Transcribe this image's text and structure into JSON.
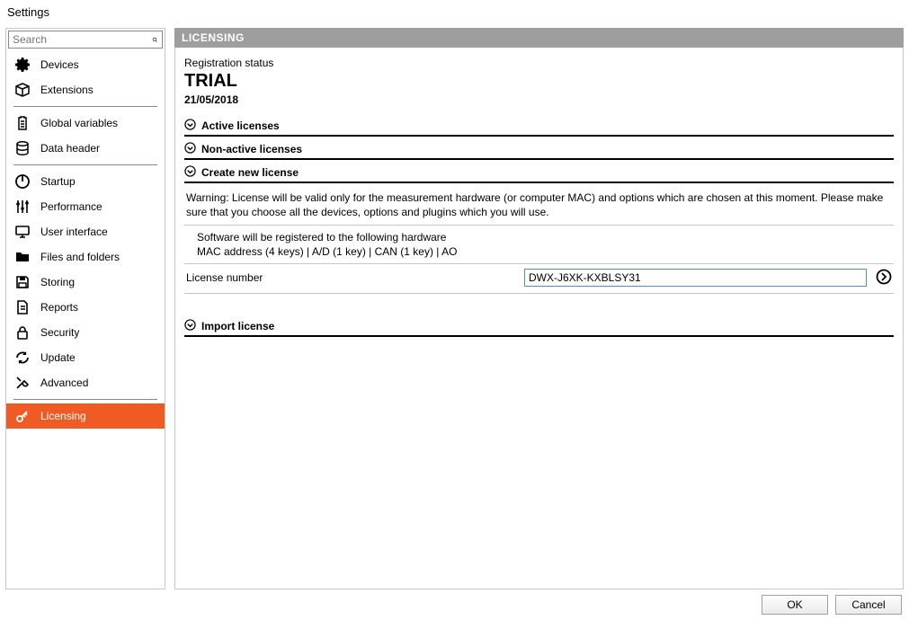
{
  "window": {
    "title": "Settings"
  },
  "search": {
    "placeholder": "Search"
  },
  "sidebar": {
    "groups": [
      {
        "items": [
          {
            "label": "Devices",
            "icon": "gear-icon"
          },
          {
            "label": "Extensions",
            "icon": "box-icon"
          }
        ]
      },
      {
        "items": [
          {
            "label": "Global variables",
            "icon": "clipboard-icon"
          },
          {
            "label": "Data header",
            "icon": "database-icon"
          }
        ]
      },
      {
        "items": [
          {
            "label": "Startup",
            "icon": "power-icon"
          },
          {
            "label": "Performance",
            "icon": "sliders-icon"
          },
          {
            "label": "User interface",
            "icon": "monitor-icon"
          },
          {
            "label": "Files and folders",
            "icon": "folder-icon"
          },
          {
            "label": "Storing",
            "icon": "save-icon"
          },
          {
            "label": "Reports",
            "icon": "document-icon"
          },
          {
            "label": "Security",
            "icon": "lock-icon"
          },
          {
            "label": "Update",
            "icon": "refresh-icon"
          },
          {
            "label": "Advanced",
            "icon": "tools-icon"
          }
        ]
      },
      {
        "items": [
          {
            "label": "Licensing",
            "icon": "key-icon",
            "active": true
          }
        ]
      }
    ]
  },
  "main": {
    "heading": "LICENSING",
    "registration_label": "Registration status",
    "status": "TRIAL",
    "date": "21/05/2018",
    "sections": {
      "active": {
        "title": "Active licenses"
      },
      "nonactive": {
        "title": "Non-active licenses"
      },
      "create": {
        "title": "Create new license",
        "warning": "Warning: License will be valid only for the measurement hardware (or computer MAC) and options which are chosen at this moment. Please make sure that you choose all the devices, options and plugins which you will use.",
        "hw_line1": "Software will be registered to the following hardware",
        "hw_line2": "MAC address (4 keys) | A/D (1 key) | CAN (1 key) | AO",
        "license_label": "License number",
        "license_value": "DWX-J6XK-KXBLSY31"
      },
      "import": {
        "title": "Import license"
      }
    }
  },
  "footer": {
    "ok": "OK",
    "cancel": "Cancel"
  }
}
